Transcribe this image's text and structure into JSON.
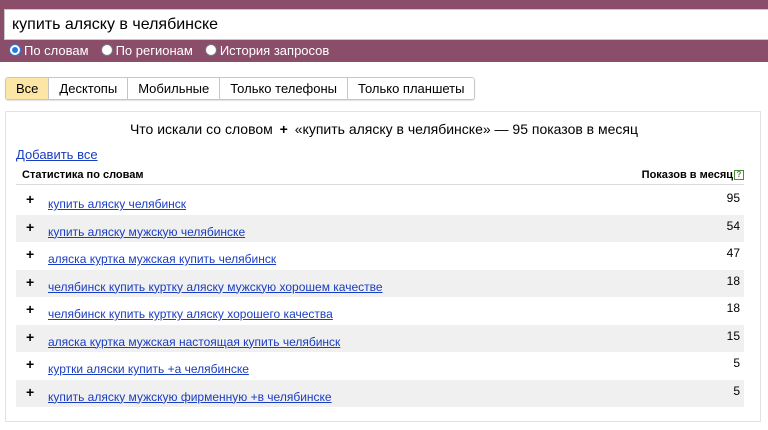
{
  "search": {
    "query": "купить аляску в челябинске"
  },
  "radio_options": [
    {
      "label": "По словам",
      "checked": true
    },
    {
      "label": "По регионам",
      "checked": false
    },
    {
      "label": "История запросов",
      "checked": false
    }
  ],
  "tabs": [
    {
      "label": "Все",
      "active": true
    },
    {
      "label": "Десктопы",
      "active": false
    },
    {
      "label": "Мобильные",
      "active": false
    },
    {
      "label": "Только телефоны",
      "active": false
    },
    {
      "label": "Только планшеты",
      "active": false
    }
  ],
  "panel": {
    "title_prefix": "Что искали со словом",
    "title_plus": "+",
    "title_suffix": "«купить аляску в челябинске» — 95 показов в месяц",
    "add_all": "Добавить все",
    "col_left": "Статистика по словам",
    "col_right": "Показов в месяц",
    "help_glyph": "?"
  },
  "rows": [
    {
      "phrase": "купить аляску челябинск",
      "count": "95"
    },
    {
      "phrase": "купить аляску мужскую челябинске",
      "count": "54"
    },
    {
      "phrase": "аляска куртка мужская купить челябинск",
      "count": "47"
    },
    {
      "phrase": "челябинск купить куртку аляску мужскую хорошем качестве",
      "count": "18"
    },
    {
      "phrase": "челябинск купить куртку аляску хорошего качества",
      "count": "18"
    },
    {
      "phrase": "аляска куртка мужская настоящая купить челябинск",
      "count": "15"
    },
    {
      "phrase": "куртки аляски купить +а челябинске",
      "count": "5"
    },
    {
      "phrase": "купить аляску мужскую фирменную +в челябинске",
      "count": "5"
    }
  ],
  "colors": {
    "topbar": "#8a4e6a",
    "tab_active": "#fbe6a5",
    "link": "#1a3dc1",
    "row_alt": "#f0f0f0"
  }
}
